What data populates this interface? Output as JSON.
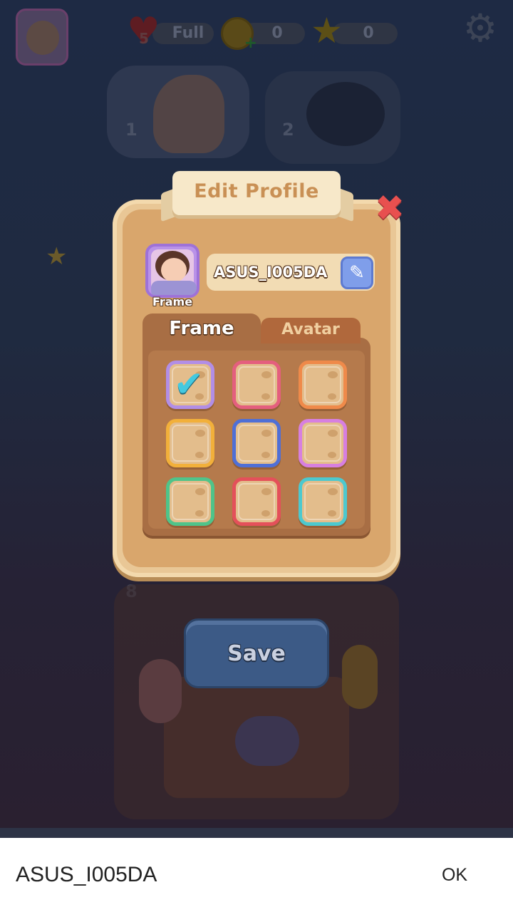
{
  "hud": {
    "lives_count": "5",
    "lives_status": "Full",
    "coins": "0",
    "stars": "0"
  },
  "background": {
    "level_1": "1",
    "level_2": "2",
    "level_8": "8"
  },
  "dialog": {
    "title": "Edit Profile",
    "avatar_caption": "Frame",
    "username": "ASUS_I005DA",
    "tabs": [
      "Frame",
      "Avatar"
    ],
    "active_tab": "Frame",
    "frames": [
      {
        "color": "#b28ee6",
        "selected": true
      },
      {
        "color": "#e45f7e",
        "selected": false
      },
      {
        "color": "#ef8a4a",
        "selected": false
      },
      {
        "color": "#f2b03a",
        "selected": false
      },
      {
        "color": "#4f6fd6",
        "selected": false
      },
      {
        "color": "#d77fe0",
        "selected": false
      },
      {
        "color": "#4fc48a",
        "selected": false
      },
      {
        "color": "#e4505a",
        "selected": false
      },
      {
        "color": "#4cc9cf",
        "selected": false
      }
    ],
    "save_label": "Save"
  },
  "ime": {
    "text": "ASUS_I005DA",
    "ok_label": "OK"
  },
  "icons": {
    "heart": "heart-icon",
    "coin": "coin-icon",
    "star": "star-icon",
    "settings": "gear-icon",
    "close": "close-icon",
    "edit": "pencil-icon",
    "check": "check-icon"
  }
}
